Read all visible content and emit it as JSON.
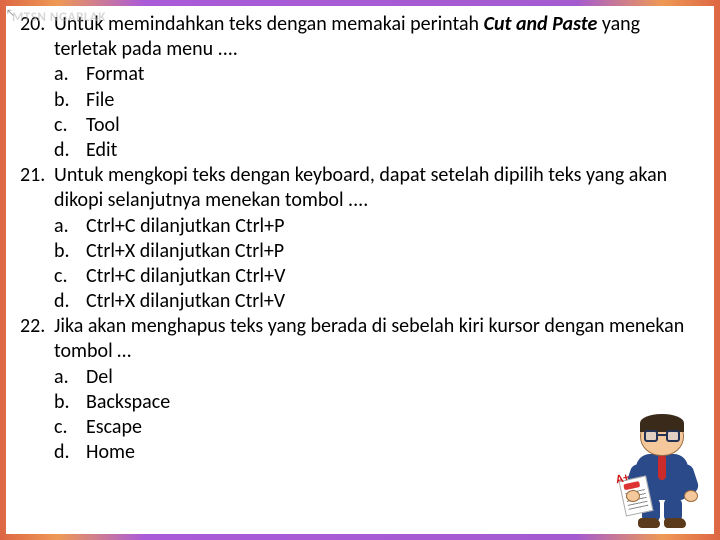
{
  "watermark": "MTSN NGABLAK",
  "questions": [
    {
      "num": "20.",
      "text_pre": "Untuk memindahkan teks dengan memakai perintah ",
      "text_em": "Cut and Paste",
      "text_post": " yang terletak pada menu ....",
      "options": [
        {
          "letter": "a.",
          "text": "Format"
        },
        {
          "letter": "b.",
          "text": "File"
        },
        {
          "letter": "c.",
          "text": "Tool"
        },
        {
          "letter": "d.",
          "text": "Edit"
        }
      ]
    },
    {
      "num": "21.",
      "text": "Untuk mengkopi teks dengan keyboard, dapat setelah dipilih teks yang akan dikopi selanjutnya menekan tombol ....",
      "options": [
        {
          "letter": "a.",
          "text": "Ctrl+C dilanjutkan Ctrl+P"
        },
        {
          "letter": "b.",
          "text": "Ctrl+X dilanjutkan Ctrl+P"
        },
        {
          "letter": "c.",
          "text": "Ctrl+C dilanjutkan Ctrl+V"
        },
        {
          "letter": "d.",
          "text": "Ctrl+X dilanjutkan Ctrl+V"
        }
      ]
    },
    {
      "num": "22.",
      "text": "Jika akan menghapus teks yang berada di sebelah kiri kursor dengan menekan tombol …",
      "options": [
        {
          "letter": "a.",
          "text": "Del"
        },
        {
          "letter": "b.",
          "text": "Backspace"
        },
        {
          "letter": "c.",
          "text": "Escape"
        },
        {
          "letter": "d.",
          "text": "Home"
        }
      ]
    }
  ],
  "mascot_badge": "A+"
}
